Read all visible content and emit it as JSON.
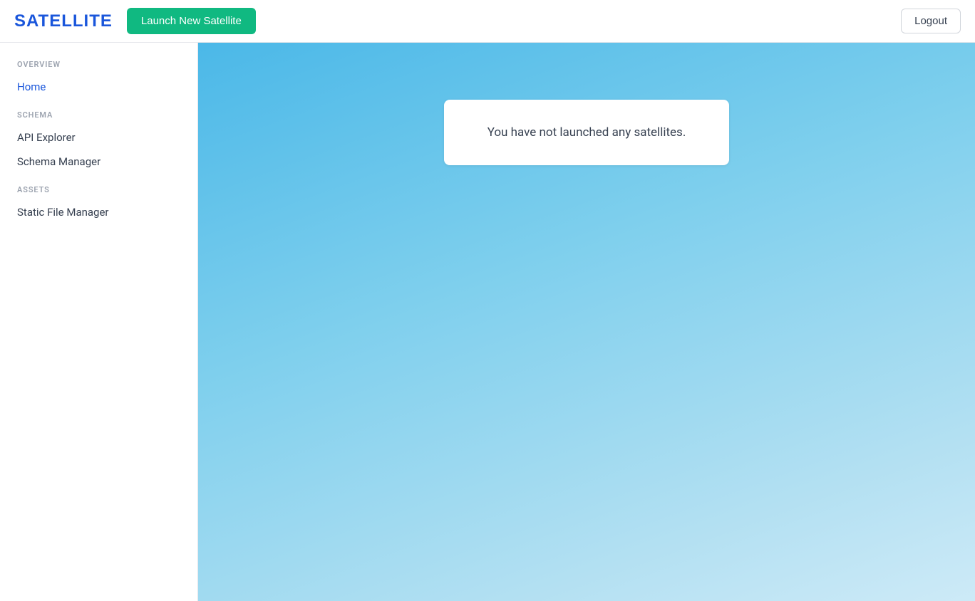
{
  "header": {
    "logo_text": "SATELLITE",
    "launch_button_label": "Launch New Satellite",
    "logout_button_label": "Logout"
  },
  "sidebar": {
    "sections": [
      {
        "label": "OVERVIEW",
        "items": [
          {
            "id": "home",
            "label": "Home",
            "active": true
          }
        ]
      },
      {
        "label": "SCHEMA",
        "items": [
          {
            "id": "api-explorer",
            "label": "API Explorer",
            "active": false
          },
          {
            "id": "schema-manager",
            "label": "Schema Manager",
            "active": false
          }
        ]
      },
      {
        "label": "ASSETS",
        "items": [
          {
            "id": "static-file-manager",
            "label": "Static File Manager",
            "active": false
          }
        ]
      }
    ]
  },
  "content": {
    "empty_message": "You have not launched any satellites."
  }
}
